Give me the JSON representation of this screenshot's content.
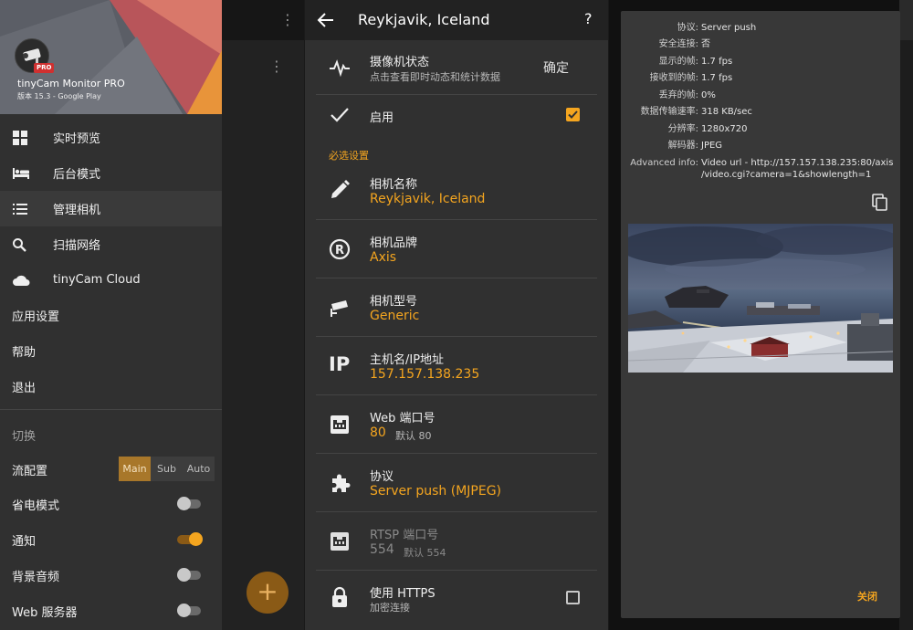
{
  "drawer": {
    "app_name": "tinyCam Monitor PRO",
    "version": "版本 15.3 - Google Play",
    "pro_badge": "PRO",
    "menu": [
      {
        "label": "实时预览",
        "icon": "grid-icon"
      },
      {
        "label": "后台模式",
        "icon": "bed-icon"
      },
      {
        "label": "管理相机",
        "icon": "list-icon",
        "active": true
      },
      {
        "label": "扫描网络",
        "icon": "search-icon"
      },
      {
        "label": "tinyCam Cloud",
        "icon": "cloud-icon"
      },
      {
        "label": "应用设置"
      },
      {
        "label": "帮助"
      },
      {
        "label": "退出"
      }
    ],
    "section_label": "切换",
    "stream": {
      "label": "流配置",
      "options": [
        "Main",
        "Sub",
        "Auto"
      ],
      "selected": "Main"
    },
    "toggles": [
      {
        "label": "省电模式",
        "on": false
      },
      {
        "label": "通知",
        "on": true
      },
      {
        "label": "背景音频",
        "on": false
      },
      {
        "label": "Web 服务器",
        "on": false
      }
    ],
    "fab_label": "+",
    "overflow_glyph": "⋮"
  },
  "settings": {
    "title": "Reykjavik, Iceland",
    "help_glyph": "?",
    "status": {
      "title": "摄像机状态",
      "subtitle": "点击查看即时动态和统计数据",
      "confirm": "确定"
    },
    "enable": {
      "title": "启用",
      "checked": true
    },
    "section": "必选设置",
    "camera_name": {
      "title": "相机名称",
      "value": "Reykjavik, Iceland"
    },
    "camera_brand": {
      "title": "相机品牌",
      "value": "Axis"
    },
    "camera_model": {
      "title": "相机型号",
      "value": "Generic"
    },
    "hostname": {
      "title": "主机名/IP地址",
      "value": "157.157.138.235",
      "icon_text": "IP"
    },
    "web_port": {
      "title": "Web 端口号",
      "value": "80",
      "default": "默认 80"
    },
    "protocol": {
      "title": "协议",
      "value": "Server push (MJPEG)"
    },
    "rtsp_port": {
      "title": "RTSP 端口号",
      "value": "554",
      "default": "默认 554"
    },
    "https": {
      "title": "使用 HTTPS",
      "subtitle": "加密连接",
      "checked": false
    }
  },
  "info": {
    "rows": [
      {
        "key": "协议:",
        "value": "Server push"
      },
      {
        "key": "安全连接:",
        "value": "否"
      },
      {
        "key": "显示的帧:",
        "value": "1.7 fps"
      },
      {
        "key": "接收到的帧:",
        "value": "1.7 fps"
      },
      {
        "key": "丢弃的帧:",
        "value": "0%"
      },
      {
        "key": "数据传输速率:",
        "value": "318 KB/sec"
      },
      {
        "key": "分辨率:",
        "value": "1280x720"
      },
      {
        "key": "解码器:",
        "value": "JPEG"
      }
    ],
    "advanced_key": "Advanced info:",
    "advanced_line1": "Video url - http://157.157.138.235:80/axis",
    "advanced_line2": "/video.cgi?camera=1&showlength=1",
    "close": "关闭"
  },
  "colors": {
    "accent": "#f4a51f",
    "panel": "#303030",
    "dialog": "#383838"
  }
}
